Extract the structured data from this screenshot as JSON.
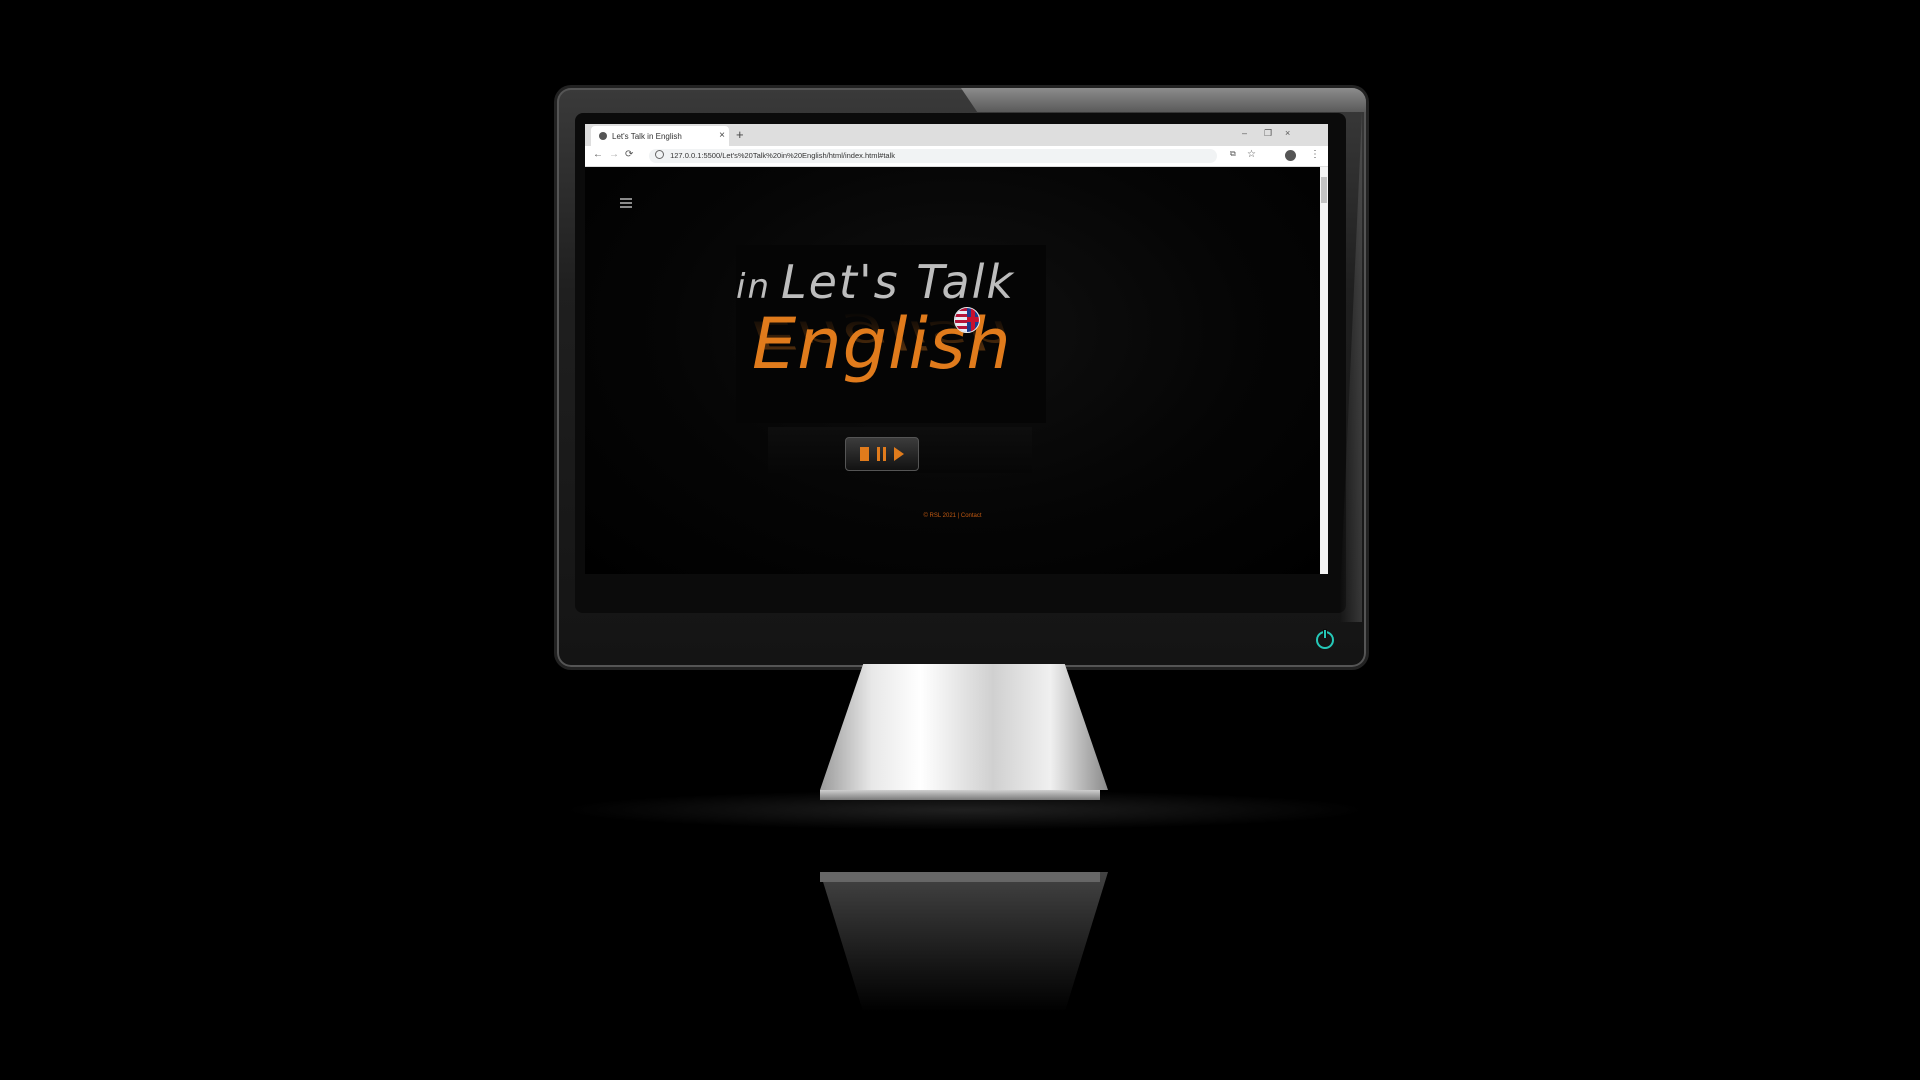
{
  "browser": {
    "tab_title": "Let's Talk in English",
    "tab_close": "×",
    "new_tab": "+",
    "window_controls": [
      "–",
      "❐",
      "×"
    ],
    "nav": [
      "←",
      "→",
      "⟳"
    ],
    "url": "127.0.0.1:5500/Let's%20Talk%20in%20English/html/index.html#talk",
    "toolbar_icons": [
      "translate-icon",
      "star-icon",
      "profile-icon",
      "more-icon"
    ],
    "star": "☆",
    "more": "⋮"
  },
  "page": {
    "logo_top_in": "in",
    "logo_top": "Let's Talk",
    "logo_main": "English",
    "footer": "© RSL 2021 | Contact",
    "colors": {
      "accent": "#e07b1c",
      "logo_gray": "#bdbdbd",
      "power": "#25c8b8"
    }
  },
  "player": {
    "controls": [
      "stop-icon",
      "pause-icon",
      "play-icon"
    ]
  }
}
